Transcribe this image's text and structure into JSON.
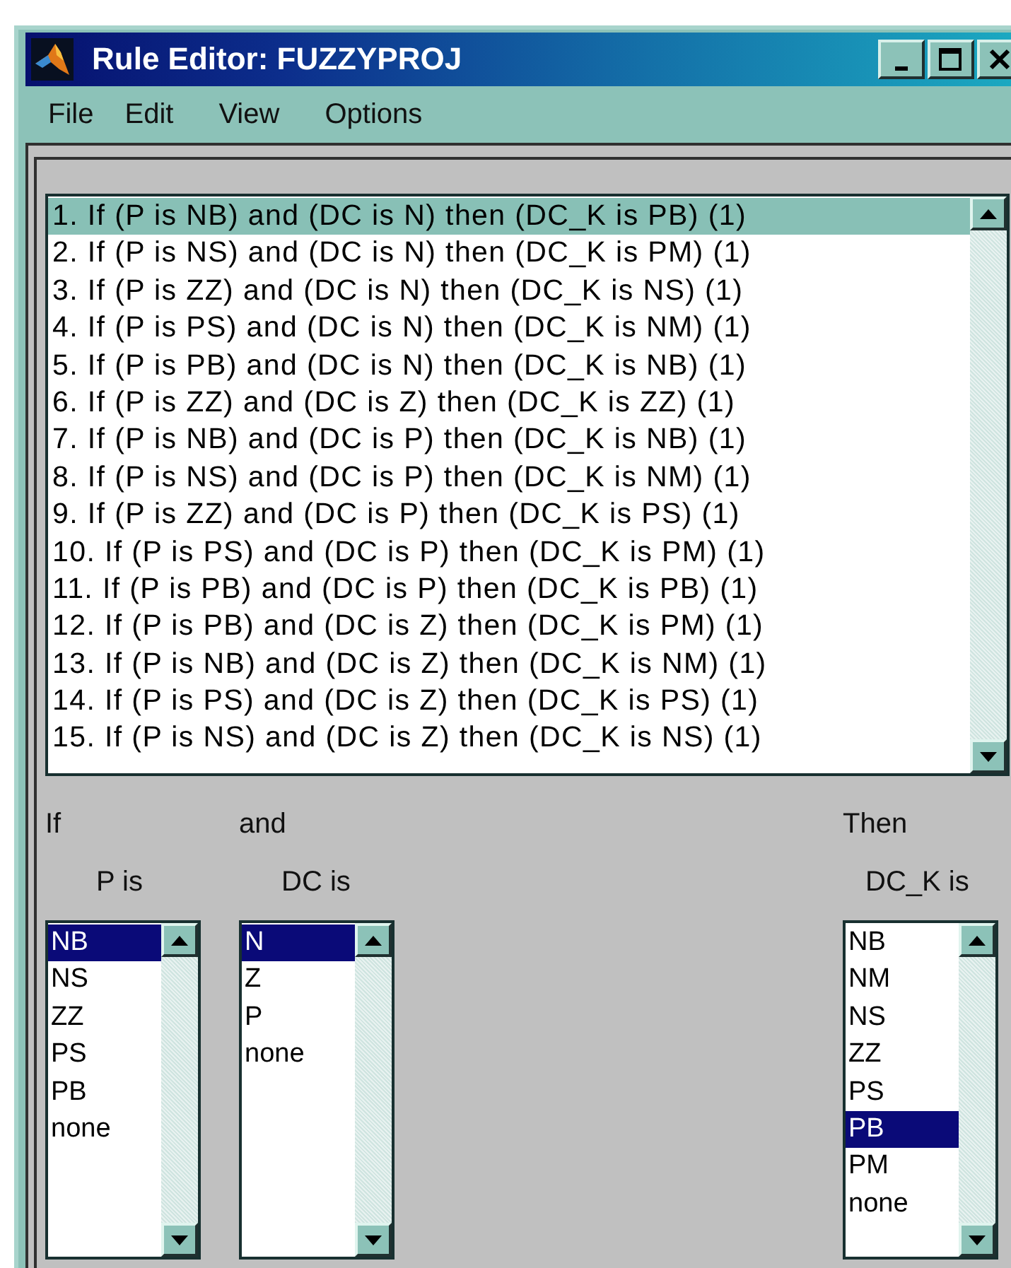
{
  "window": {
    "title": "Rule Editor: FUZZYPROJ"
  },
  "menu": [
    "File",
    "Edit",
    "View",
    "Options"
  ],
  "rules": [
    {
      "text": "1. If (P is NB) and (DC is N) then (DC_K is PB) (1)",
      "selected": true
    },
    {
      "text": "2. If (P is NS) and (DC is N) then (DC_K is PM) (1)",
      "selected": false
    },
    {
      "text": "3. If (P is ZZ) and (DC is N) then (DC_K is NS) (1)",
      "selected": false
    },
    {
      "text": "4. If (P is PS) and (DC is N) then (DC_K is NM) (1)",
      "selected": false
    },
    {
      "text": "5. If (P is PB) and (DC is N) then (DC_K is NB) (1)",
      "selected": false
    },
    {
      "text": "6. If (P is ZZ) and (DC is Z) then (DC_K is ZZ) (1)",
      "selected": false
    },
    {
      "text": "7. If (P is NB) and (DC is P) then (DC_K is NB) (1)",
      "selected": false
    },
    {
      "text": "8. If (P is NS) and (DC is P) then (DC_K is NM) (1)",
      "selected": false
    },
    {
      "text": "9. If (P is ZZ) and (DC is P) then (DC_K is PS) (1)",
      "selected": false
    },
    {
      "text": "10. If (P is PS) and (DC is P) then (DC_K is PM) (1)",
      "selected": false
    },
    {
      "text": "11. If (P is PB) and (DC is P) then (DC_K is PB) (1)",
      "selected": false
    },
    {
      "text": "12. If (P is PB) and (DC is Z) then (DC_K is PM) (1)",
      "selected": false
    },
    {
      "text": "13. If (P is NB) and (DC is Z) then (DC_K is NM) (1)",
      "selected": false
    },
    {
      "text": "14. If (P is PS) and (DC is Z) then (DC_K is PS) (1)",
      "selected": false
    },
    {
      "text": "15. If (P is NS) and (DC is Z) then (DC_K is NS) (1)",
      "selected": false
    }
  ],
  "antecedents": [
    {
      "connector": "If",
      "label": "P is",
      "items": [
        {
          "text": "NB",
          "selected": true
        },
        {
          "text": "NS",
          "selected": false
        },
        {
          "text": "ZZ",
          "selected": false
        },
        {
          "text": "PS",
          "selected": false
        },
        {
          "text": "PB",
          "selected": false
        },
        {
          "text": "none",
          "selected": false
        }
      ]
    },
    {
      "connector": "and",
      "label": "DC is",
      "items": [
        {
          "text": "N",
          "selected": true
        },
        {
          "text": "Z",
          "selected": false
        },
        {
          "text": "P",
          "selected": false
        },
        {
          "text": "none",
          "selected": false
        }
      ]
    }
  ],
  "consequent": {
    "connector": "Then",
    "label": "DC_K is",
    "items": [
      {
        "text": "NB",
        "selected": false
      },
      {
        "text": "NM",
        "selected": false
      },
      {
        "text": "NS",
        "selected": false
      },
      {
        "text": "ZZ",
        "selected": false
      },
      {
        "text": "PS",
        "selected": false
      },
      {
        "text": "PB",
        "selected": true
      },
      {
        "text": "PM",
        "selected": false
      },
      {
        "text": "none",
        "selected": false
      }
    ]
  }
}
